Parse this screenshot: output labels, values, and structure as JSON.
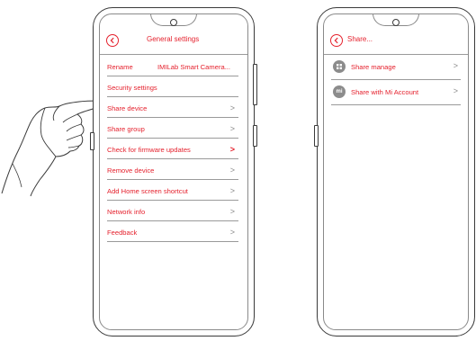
{
  "left_phone": {
    "title": "General settings",
    "rows": [
      {
        "label": "Rename",
        "value": "IMILab Smart Camera...",
        "chevron": ""
      },
      {
        "label": "Security settings",
        "value": "",
        "chevron": ""
      },
      {
        "label": "Share device",
        "value": "",
        "chevron": ">"
      },
      {
        "label": "Share group",
        "value": "",
        "chevron": ">"
      },
      {
        "label": "Check for firmware updates",
        "value": "",
        "chevron": ">"
      },
      {
        "label": "Remove device",
        "value": "",
        "chevron": ">"
      },
      {
        "label": "Add Home screen shortcut",
        "value": "",
        "chevron": ">"
      },
      {
        "label": "Network info",
        "value": "",
        "chevron": ">"
      },
      {
        "label": "Feedback",
        "value": "",
        "chevron": ">"
      }
    ]
  },
  "right_phone": {
    "title": "Share...",
    "rows": [
      {
        "label": "Share manage",
        "icon": "share-manage-icon",
        "chevron": ">"
      },
      {
        "label": "Share with Mi Account",
        "icon": "mi-account-icon",
        "icon_text": "mi",
        "chevron": ">"
      }
    ]
  },
  "colors": {
    "accent": "#e5222e",
    "line": "#9a9a9a",
    "frame": "#3a3a3a"
  }
}
